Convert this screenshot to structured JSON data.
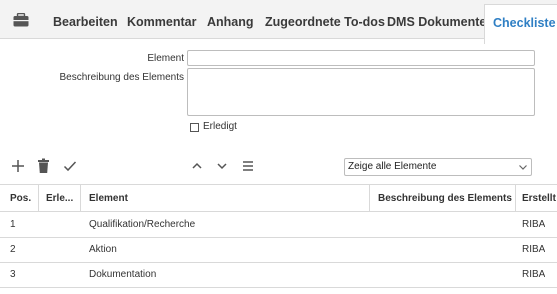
{
  "tabs": [
    {
      "label": "Bearbeiten"
    },
    {
      "label": "Kommentar"
    },
    {
      "label": "Anhang"
    },
    {
      "label": "Zugeordnete To-dos"
    },
    {
      "label": "DMS Dokumente"
    },
    {
      "label": "Checkliste",
      "active": true
    }
  ],
  "form": {
    "element_label": "Element",
    "element_value": "",
    "description_label": "Beschreibung des Elements",
    "description_value": "",
    "done_label": "Erledigt",
    "done_checked": false
  },
  "toolbar": {
    "filter_selected": "Zeige alle Elemente"
  },
  "table": {
    "columns": [
      "Pos.",
      "Erle...",
      "Element",
      "Beschreibung des Elements",
      "Erstellt"
    ],
    "rows": [
      {
        "pos": "1",
        "done": "",
        "element": "Qualifikation/Recherche",
        "description": "",
        "created": "RIBA"
      },
      {
        "pos": "2",
        "done": "",
        "element": "Aktion",
        "description": "",
        "created": "RIBA"
      },
      {
        "pos": "3",
        "done": "",
        "element": "Dokumentation",
        "description": "",
        "created": "RIBA"
      }
    ]
  },
  "colors": {
    "accent": "#2f7fc4",
    "tab_bar": "#f3f3f3",
    "border": "#d9d9d9"
  },
  "icons": [
    "briefcase-icon",
    "add-icon",
    "trash-icon",
    "check-icon",
    "chevron-up-icon",
    "chevron-down-icon",
    "menu-icon",
    "dropdown-arrow-icon"
  ]
}
